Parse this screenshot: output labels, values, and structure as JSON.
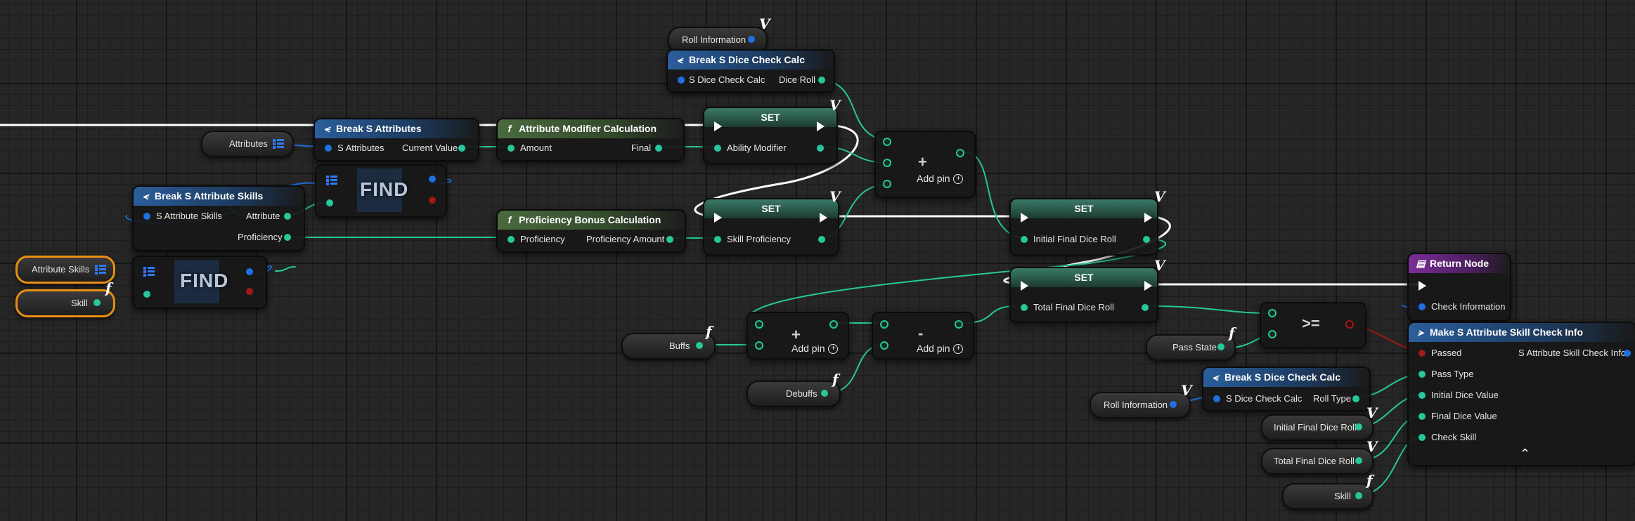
{
  "nodes": {
    "roll_info_var_top": "Roll Information",
    "break_dice_top": {
      "title": "Break S Dice Check Calc",
      "in": "S Dice Check Calc",
      "out": "Dice Roll"
    },
    "attributes_var": "Attributes",
    "break_attributes": {
      "title": "Break S Attributes",
      "in": "S Attributes",
      "out": "Current Value"
    },
    "find1": "FIND",
    "attr_mod_calc": {
      "title": "Attribute Modifier Calculation",
      "in": "Amount",
      "out": "Final"
    },
    "set1": {
      "title": "SET",
      "pin": "Ability Modifier"
    },
    "add1": {
      "label": "Add pin",
      "op": "+"
    },
    "break_attr_skills": {
      "title": "Break S Attribute Skills",
      "in": "S Attribute Skills",
      "out1": "Attribute",
      "out2": "Proficiency"
    },
    "prof_calc": {
      "title": "Proficiency Bonus Calculation",
      "in": "Proficiency",
      "out": "Proficiency Amount"
    },
    "set2": {
      "title": "SET",
      "pin": "Skill Proficiency"
    },
    "set3": {
      "title": "SET",
      "pin": "Initial Final Dice Roll"
    },
    "set4": {
      "title": "SET",
      "pin": "Total Final Dice Roll"
    },
    "attr_skills_var": "Attribute Skills",
    "skill_var_left": "Skill",
    "find2": "FIND",
    "buffs_var": "Buffs",
    "add2": {
      "label": "Add pin",
      "op": "+"
    },
    "sub": {
      "label": "Add pin",
      "op": "-"
    },
    "debuffs_var": "Debuffs",
    "compare": {
      "op": ">="
    },
    "pass_state_var": "Pass State",
    "return_node": {
      "title": "Return Node",
      "pin": "Check Information"
    },
    "make_info": {
      "title": "Make S Attribute Skill Check Info",
      "out": "S Attribute Skill Check Info",
      "pins": [
        "Passed",
        "Pass Type",
        "Initial Dice Value",
        "Final Dice Value",
        "Check Skill"
      ]
    },
    "roll_info_var_bottom": "Roll Information",
    "break_dice_bottom": {
      "title": "Break S Dice Check Calc",
      "in": "S Dice Check Calc",
      "out": "Roll Type"
    },
    "init_roll_var": "Initial Final Dice Roll",
    "total_roll_var": "Total Final Dice Roll",
    "skill_var_right": "Skill"
  },
  "badges": {
    "var": "V",
    "func": "f"
  },
  "icons": {
    "break": "break-struct-icon",
    "function": "function-icon",
    "array": "array-icon",
    "return": "return-node-icon",
    "make": "make-struct-icon",
    "add": "add-pin-icon"
  },
  "colors": {
    "exec": "#ffffff",
    "struct": "#1f6fe0",
    "int": "#26c79a",
    "bool": "#a01818",
    "selected": "#e88e12",
    "struct_header": "#2b5e9c",
    "function_header": "#4a6a3e",
    "return_header": "#7a2e96"
  }
}
